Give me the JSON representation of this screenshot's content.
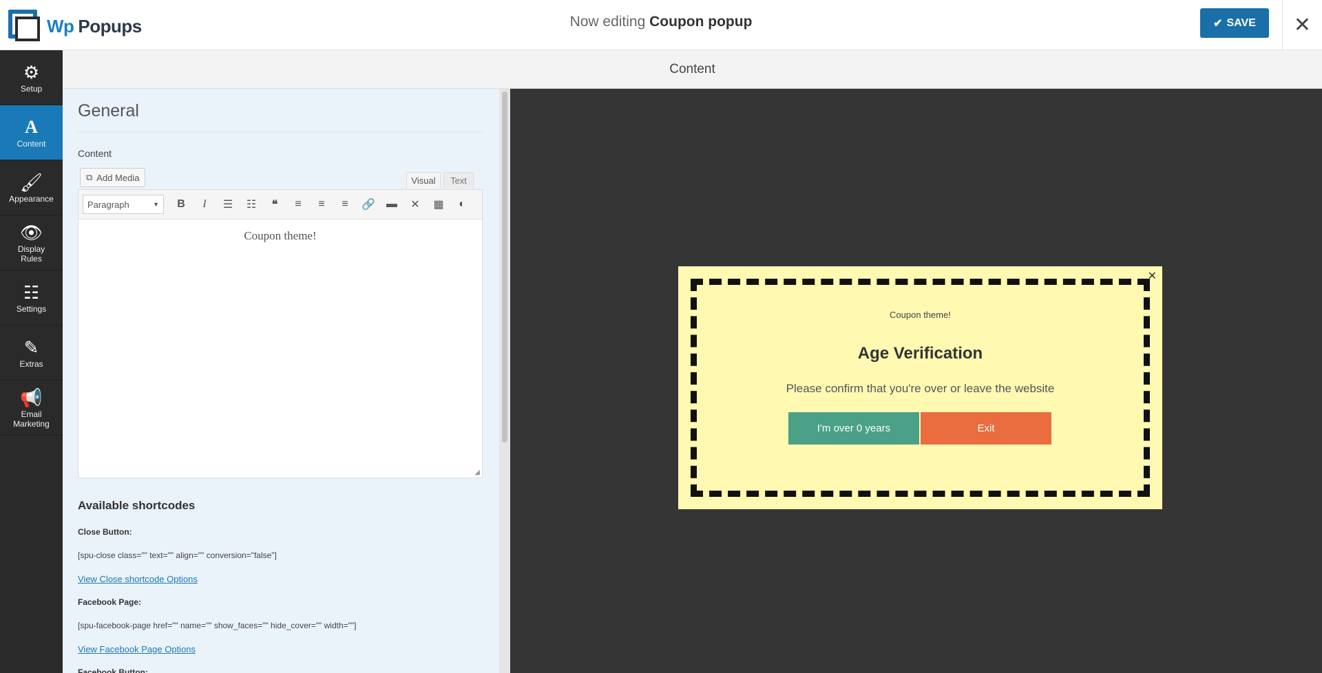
{
  "header": {
    "logo_wp": "Wp",
    "logo_name": "Popups",
    "editing_prefix": "Now editing",
    "editing_name": "Coupon popup",
    "save_label": "SAVE",
    "close_glyph": "✕"
  },
  "sidebar": {
    "items": [
      {
        "label": "Setup",
        "icon": "gear-icon",
        "glyph": "⚙"
      },
      {
        "label": "Content",
        "icon": "font-a-icon",
        "glyph": "A"
      },
      {
        "label": "Appearance",
        "icon": "brush-icon",
        "glyph": "🖌"
      },
      {
        "label": "Display Rules",
        "icon": "eye-icon",
        "glyph": "👁"
      },
      {
        "label": "Settings",
        "icon": "sliders-icon",
        "glyph": "☷"
      },
      {
        "label": "Extras",
        "icon": "magic-wand-icon",
        "glyph": "✎"
      },
      {
        "label": "Email Marketing",
        "icon": "megaphone-icon",
        "glyph": "📢"
      }
    ],
    "active": "Content"
  },
  "section_title": "Content",
  "panel": {
    "title": "General",
    "content_label": "Content",
    "add_media_label": "Add Media",
    "tab_visual": "Visual",
    "tab_text": "Text",
    "format_select": "Paragraph",
    "editor_text": "Coupon theme!",
    "shortcodes_title": "Available shortcodes",
    "close_button_label": "Close Button:",
    "close_button_code": "[spu-close class=\"\" text=\"\" align=\"\" conversion=\"false\"]",
    "close_button_link": "View Close shortcode Options",
    "facebook_page_label": "Facebook Page:",
    "facebook_page_code": "[spu-facebook-page href=\"\" name=\"\" show_faces=\"\" hide_cover=\"\" width=\"\"]",
    "facebook_page_link": "View Facebook Page Options",
    "facebook_button_label": "Facebook Button:"
  },
  "popup": {
    "small_text": "Coupon theme!",
    "heading": "Age Verification",
    "text": "Please confirm that you're over or leave the website",
    "yes_label": "I'm over 0 years",
    "exit_label": "Exit",
    "close_glyph": "✕"
  },
  "colors": {
    "accent": "#1a7ab8",
    "popup_bg": "#fff9b2",
    "yes_button": "#4aa188",
    "exit_button": "#e96d3e"
  }
}
